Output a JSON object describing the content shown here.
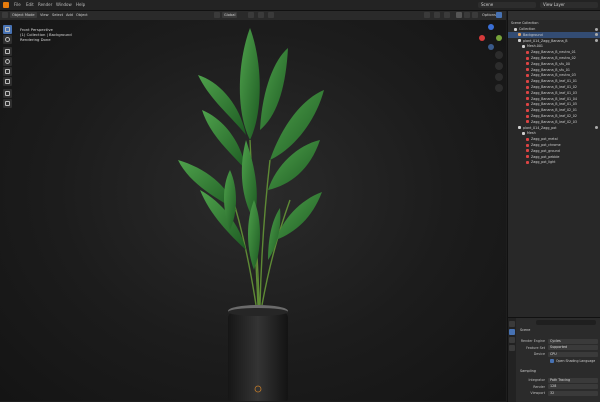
{
  "topbar": {
    "menus": [
      "File",
      "Edit",
      "Render",
      "Window",
      "Help"
    ],
    "scene": "Scene",
    "view_layer": "View Layer"
  },
  "viewport_header": {
    "mode": "Object Mode",
    "menus": [
      "View",
      "Select",
      "Add",
      "Object"
    ],
    "transform": "Global",
    "options": "Options"
  },
  "viewport_info": {
    "line1": "Front Perspective",
    "line2": "(1) Collection | Background",
    "line3": "Rendering Done"
  },
  "outliner": {
    "title": "Scene Collection",
    "rows": [
      {
        "label": "Collection",
        "indent": 1,
        "icon": "collection-icon",
        "color": "#cfcfcf"
      },
      {
        "label": "Background",
        "indent": 2,
        "icon": "object-icon",
        "color": "#e0a060",
        "selected": true
      },
      {
        "label": "plant_014_Zagg_Banana_B",
        "indent": 2,
        "icon": "collection-icon",
        "color": "#cfcfcf"
      },
      {
        "label": "Mesh.001",
        "indent": 3,
        "icon": "mesh-icon",
        "color": "#cfcfcf"
      },
      {
        "label": "Zagg_Banana_B_neutro_01",
        "indent": 4,
        "icon": "material-icon",
        "color": "#d44"
      },
      {
        "label": "Zagg_Banana_B_neutro_02",
        "indent": 4,
        "icon": "material-icon",
        "color": "#d44"
      },
      {
        "label": "Zagg_Banana_B_sfu_00",
        "indent": 4,
        "icon": "material-icon",
        "color": "#d44"
      },
      {
        "label": "Zagg_Banana_B_sfu_01",
        "indent": 4,
        "icon": "material-icon",
        "color": "#d44"
      },
      {
        "label": "Zagg_Banana_B_neutro_03",
        "indent": 4,
        "icon": "material-icon",
        "color": "#d44"
      },
      {
        "label": "Zagg_Banana_B_leaf_01_01",
        "indent": 4,
        "icon": "material-icon",
        "color": "#d44"
      },
      {
        "label": "Zagg_Banana_B_leaf_01_02",
        "indent": 4,
        "icon": "material-icon",
        "color": "#d44"
      },
      {
        "label": "Zagg_Banana_B_leaf_01_03",
        "indent": 4,
        "icon": "material-icon",
        "color": "#d44"
      },
      {
        "label": "Zagg_Banana_B_leaf_01_04",
        "indent": 4,
        "icon": "material-icon",
        "color": "#d44"
      },
      {
        "label": "Zagg_Banana_B_leaf_01_05",
        "indent": 4,
        "icon": "material-icon",
        "color": "#d44"
      },
      {
        "label": "Zagg_Banana_B_leaf_02_01",
        "indent": 4,
        "icon": "material-icon",
        "color": "#d44"
      },
      {
        "label": "Zagg_Banana_B_leaf_02_02",
        "indent": 4,
        "icon": "material-icon",
        "color": "#d44"
      },
      {
        "label": "Zagg_Banana_B_leaf_02_03",
        "indent": 4,
        "icon": "material-icon",
        "color": "#d44"
      },
      {
        "label": "plant_014_Zagg_pot",
        "indent": 2,
        "icon": "collection-icon",
        "color": "#cfcfcf"
      },
      {
        "label": "Mesh",
        "indent": 3,
        "icon": "mesh-icon",
        "color": "#cfcfcf"
      },
      {
        "label": "Zagg_pot_metal",
        "indent": 4,
        "icon": "material-icon",
        "color": "#d44"
      },
      {
        "label": "Zagg_pot_chrome",
        "indent": 4,
        "icon": "material-icon",
        "color": "#d44"
      },
      {
        "label": "Zagg_pot_ground",
        "indent": 4,
        "icon": "material-icon",
        "color": "#d44"
      },
      {
        "label": "Zagg_pot_pebble",
        "indent": 4,
        "icon": "material-icon",
        "color": "#d44"
      },
      {
        "label": "Zagg_pot_light",
        "indent": 4,
        "icon": "material-icon",
        "color": "#d44"
      }
    ]
  },
  "properties": {
    "search": "",
    "scene_label": "Scene",
    "fields": [
      {
        "label": "Render Engine",
        "value": "Cycles"
      },
      {
        "label": "Feature Set",
        "value": "Supported"
      },
      {
        "label": "Device",
        "value": "CPU"
      }
    ],
    "checkbox": "Open Shading Language",
    "section": "Sampling",
    "section_fields": [
      {
        "label": "Integrator",
        "value": "Path Tracing"
      },
      {
        "label": "Render",
        "value": "128"
      },
      {
        "label": "Viewport",
        "value": "32"
      }
    ]
  },
  "colors": {
    "accent": "#4772b3",
    "blender_orange": "#e87d0d",
    "axis_x": "#d63a3a",
    "axis_y": "#76a33a",
    "axis_z": "#3a6fd6"
  }
}
